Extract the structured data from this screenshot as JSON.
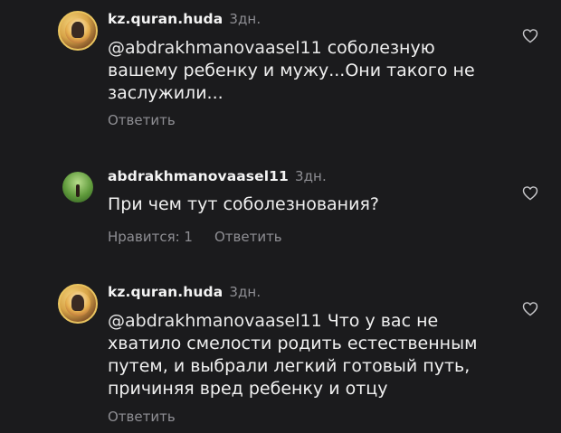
{
  "comments": [
    {
      "username": "kz.quran.huda",
      "time": "3дн.",
      "mention": "@abdrakhmanovaasel11",
      "text": " соболезную\nвашему ребенку и мужу...Они такого не\nзаслужили...",
      "reply_label": "Ответить"
    },
    {
      "username": "abdrakhmanovaasel11",
      "time": "3дн.",
      "mention": "",
      "text": "При чем тут соболезнования?",
      "likes_label": "Нравится: 1",
      "reply_label": "Ответить"
    },
    {
      "username": "kz.quran.huda",
      "time": "3дн.",
      "mention": "@abdrakhmanovaasel11",
      "text": " Что у вас не\nхватило смелости родить естественным\nпутем, и выбрали легкий готовый путь,\nпричиняя вред ребенку и отцу",
      "reply_label": "Ответить"
    }
  ]
}
